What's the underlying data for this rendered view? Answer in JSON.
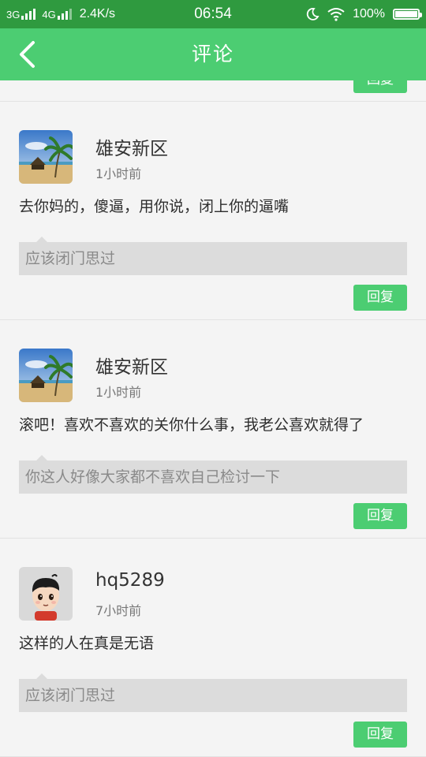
{
  "status_bar": {
    "network1": "3G",
    "network2": "4G",
    "speed": "2.4K/s",
    "time": "06:54",
    "battery": "100%"
  },
  "header": {
    "title": "评论"
  },
  "partial_item": {
    "reply_label": "回复"
  },
  "comments": [
    {
      "user": "雄安新区",
      "time": "1小时前",
      "content": "去你妈的，傻逼，用你说，闭上你的逼嘴",
      "quote": "应该闭门思过",
      "reply_label": "回复"
    },
    {
      "user": "雄安新区",
      "time": "1小时前",
      "content": "滚吧！喜欢不喜欢的关你什么事，我老公喜欢就得了",
      "quote": "你这人好像大家都不喜欢自己检讨一下",
      "reply_label": "回复"
    },
    {
      "user": "hq5289",
      "time": "7小时前",
      "content": "这样的人在真是无语",
      "quote": "应该闭门思过",
      "reply_label": "回复"
    }
  ],
  "colors": {
    "status_bar": "#2f9a3f",
    "accent": "#4ccd72",
    "background": "#f4f4f4",
    "quote_bg": "#dcdcdc"
  }
}
